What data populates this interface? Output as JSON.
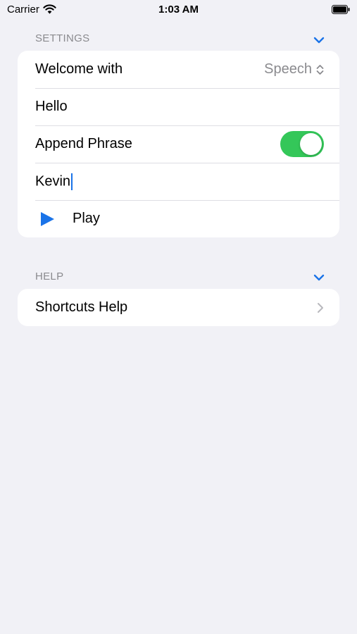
{
  "status_bar": {
    "carrier": "Carrier",
    "time": "1:03 AM"
  },
  "settings": {
    "header": "SETTINGS",
    "welcome_label": "Welcome with",
    "welcome_value": "Speech",
    "greeting_value": "Hello",
    "append_label": "Append Phrase",
    "append_enabled": true,
    "name_value": "Kevin",
    "play_label": "Play"
  },
  "help": {
    "header": "HELP",
    "shortcuts_label": "Shortcuts Help"
  },
  "colors": {
    "accent": "#1a73e8",
    "toggle_on": "#34c759",
    "background": "#f1f1f6",
    "secondary_text": "#8a8a8e"
  }
}
